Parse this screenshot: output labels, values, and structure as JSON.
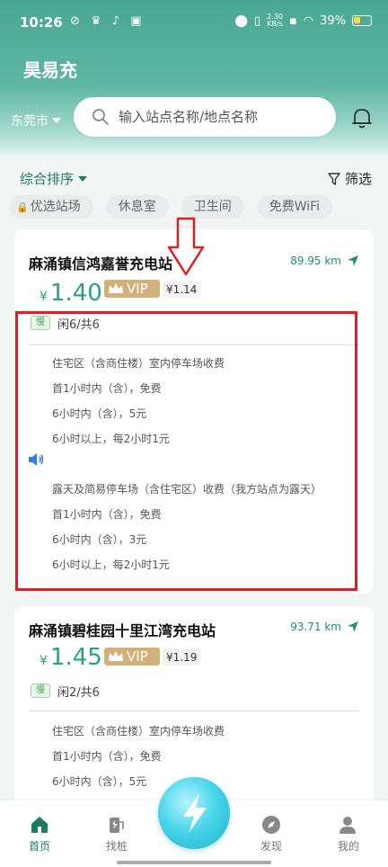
{
  "status_bar": {
    "time": "10:26",
    "net_speed_value": "2.30",
    "net_speed_unit": "KB/s",
    "battery": "39%"
  },
  "app": {
    "title": "昊易充"
  },
  "header": {
    "city": "东莞市",
    "search_placeholder": "输入站点名称/地点名称"
  },
  "sortbar": {
    "sort_label": "综合排序",
    "filter_label": "筛选"
  },
  "chips": [
    "优选站场",
    "休息室",
    "卫生间",
    "免费WiFi"
  ],
  "stations": [
    {
      "name": "麻涌镇信鸿嘉誉充电站",
      "distance": "89.95 km",
      "currency": "¥",
      "price": "1.40",
      "vip_label": "VIP",
      "vip_price": "¥1.14",
      "slow_tag": "慢",
      "idle": "闲6",
      "total": "/共6",
      "parking_rules": [
        "住宅区（含商住楼）室内停车场收费",
        "首1小时内（含），免费",
        "6小时内（含），5元",
        "6小时以上，每2小时1元",
        "露天及简易停车场（含住宅区）收费（我方站点为露天）",
        "首1小时内（含），免费",
        "6小时内（含），3元",
        "6小时以上，每2小时1元"
      ]
    },
    {
      "name": "麻涌镇碧桂园十里江湾充电站",
      "distance": "93.71 km",
      "currency": "¥",
      "price": "1.45",
      "vip_label": "VIP",
      "vip_price": "¥1.19",
      "slow_tag": "慢",
      "idle": "闲2",
      "total": "/共6",
      "parking_rules": [
        "住宅区（含商住楼）室内停车场收费",
        "首1小时内（含），免费",
        "6小时内（含），5元"
      ]
    }
  ],
  "nav": {
    "home": "首页",
    "find": "找桩",
    "discover": "发现",
    "mine": "我的"
  },
  "colors": {
    "brand": "#4aa792",
    "accent": "#28a283",
    "vip": "#d2b07a",
    "highlight": "#e02020"
  }
}
